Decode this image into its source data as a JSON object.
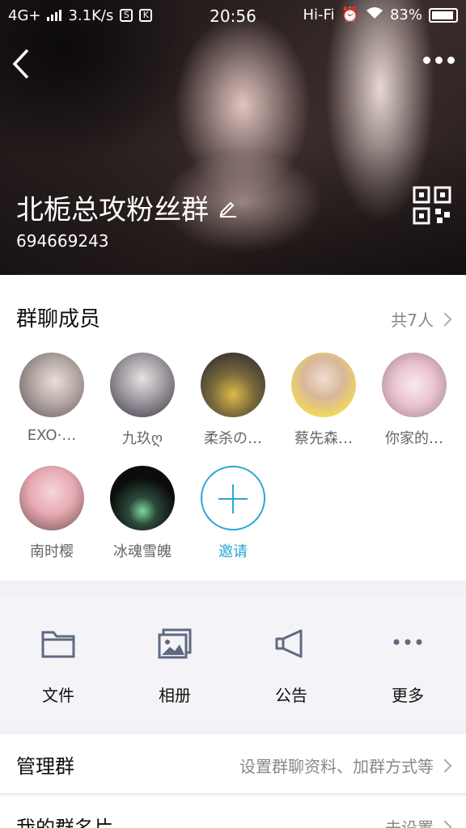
{
  "status_bar": {
    "network": "4G+",
    "speed": "3.1K/s",
    "box1": "S",
    "box2": "K",
    "time": "20:56",
    "hifi": "Hi-Fi",
    "battery": "83%"
  },
  "header": {
    "group_name": "北栀总攻粉丝群",
    "group_id": "694669243"
  },
  "members": {
    "title": "群聊成员",
    "count_label": "共7人",
    "items": [
      {
        "name": "EXO·…",
        "color1": "#d9d3cf",
        "color2": "#7a6d6b"
      },
      {
        "name": "九玖ღ",
        "color1": "#c7c2c4",
        "color2": "#3d3a40"
      },
      {
        "name": "柔杀の…",
        "color1": "#e0b94a",
        "color2": "#2a2a3b"
      },
      {
        "name": "蔡先森…",
        "color1": "#f1d85c",
        "color2": "#d9b99a"
      },
      {
        "name": "你家的…",
        "color1": "#f3d6e2",
        "color2": "#b89a9a"
      },
      {
        "name": "南时樱",
        "color1": "#f2c3c9",
        "color2": "#8e6a6a"
      },
      {
        "name": "冰魂雪魄",
        "color1": "#2a2a2a",
        "color2": "#0a0a0a"
      }
    ],
    "invite_label": "邀请"
  },
  "actions": [
    {
      "label": "文件",
      "icon": "folder-icon"
    },
    {
      "label": "相册",
      "icon": "album-icon"
    },
    {
      "label": "公告",
      "icon": "megaphone-icon"
    },
    {
      "label": "更多",
      "icon": "more-icon"
    }
  ],
  "rows": [
    {
      "title": "管理群",
      "value": "设置群聊资料、加群方式等"
    },
    {
      "title": "我的群名片",
      "value": "未设置"
    }
  ],
  "colors": {
    "accent": "#2aa5d8",
    "text": "#111111",
    "muted": "#888888"
  }
}
